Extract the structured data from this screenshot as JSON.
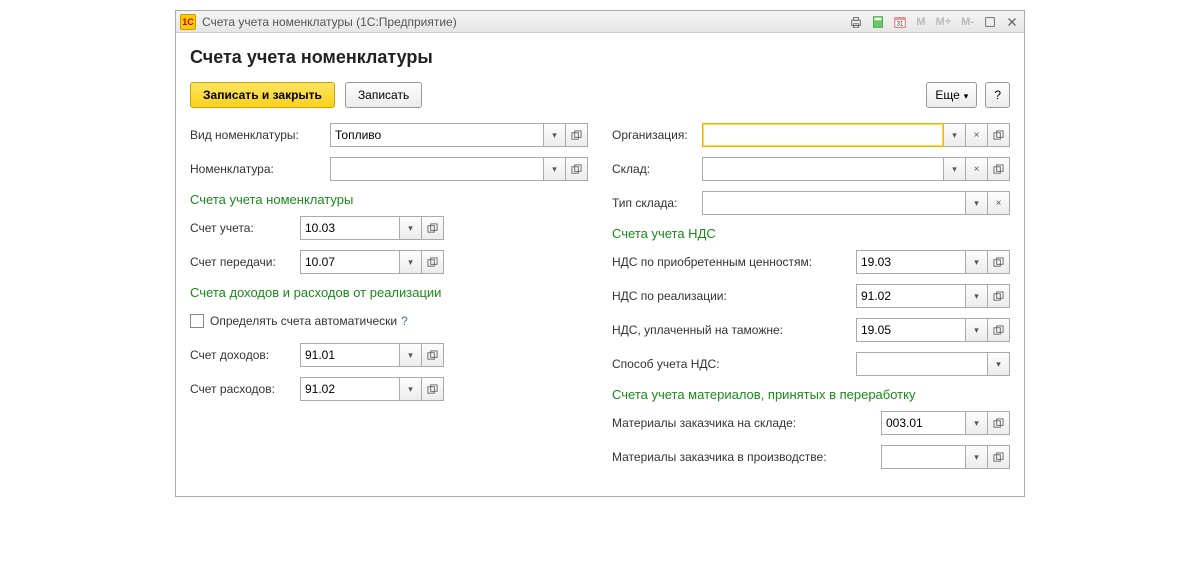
{
  "window": {
    "title": "Счета учета номенклатуры  (1С:Предприятие)",
    "logo": "1С"
  },
  "page": {
    "heading": "Счета учета номенклатуры"
  },
  "toolbar": {
    "save_close": "Записать и закрыть",
    "save": "Записать",
    "more": "Еще",
    "help": "?"
  },
  "left": {
    "nomenclature_type_label": "Вид номенклатуры:",
    "nomenclature_type_value": "Топливо",
    "nomenclature_label": "Номенклатура:",
    "nomenclature_value": ""
  },
  "right": {
    "org_label": "Организация:",
    "org_value": "",
    "warehouse_label": "Склад:",
    "warehouse_value": "",
    "warehouse_type_label": "Тип склада:",
    "warehouse_type_value": ""
  },
  "accounts": {
    "section": "Счета учета номенклатуры",
    "account_label": "Счет учета:",
    "account_value": "10.03",
    "transfer_label": "Счет передачи:",
    "transfer_value": "10.07"
  },
  "vat": {
    "section": "Счета учета НДС",
    "acquired_label": "НДС по приобретенным ценностям:",
    "acquired_value": "19.03",
    "sales_label": "НДС по реализации:",
    "sales_value": "91.02",
    "customs_label": "НДС, уплаченный на таможне:",
    "customs_value": "19.05",
    "method_label": "Способ учета НДС:",
    "method_value": ""
  },
  "pl": {
    "section": "Счета доходов и расходов от реализации",
    "auto_label": "Определять счета автоматически",
    "income_label": "Счет доходов:",
    "income_value": "91.01",
    "expense_label": "Счет расходов:",
    "expense_value": "91.02"
  },
  "materials": {
    "section": "Счета учета материалов, принятых в переработку",
    "stock_label": "Материалы заказчика на складе:",
    "stock_value": "003.01",
    "prod_label": "Материалы заказчика в производстве:",
    "prod_value": ""
  }
}
